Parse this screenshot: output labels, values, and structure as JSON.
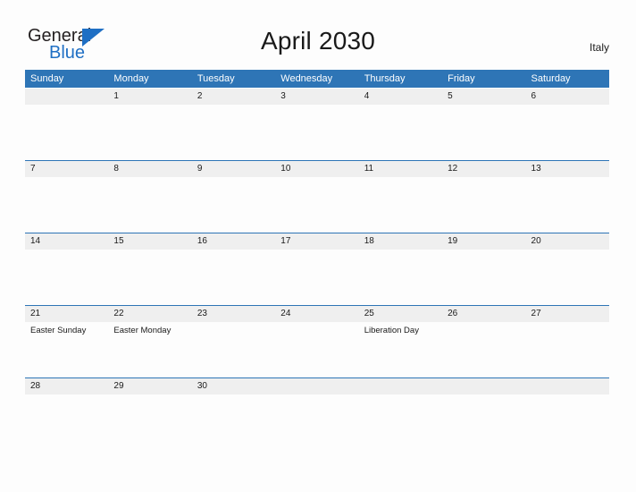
{
  "brand": {
    "name_part1": "General",
    "name_part2": "Blue",
    "triangle_icon": "triangle-icon",
    "accent_color": "#1f6fc4"
  },
  "header": {
    "title": "April 2030",
    "country": "Italy"
  },
  "colors": {
    "header_blue": "#2e75b6",
    "band_gray": "#efefef",
    "page_background": "#fdfdfd",
    "text": "#1a1a1a"
  },
  "calendar": {
    "weekdays": [
      "Sunday",
      "Monday",
      "Tuesday",
      "Wednesday",
      "Thursday",
      "Friday",
      "Saturday"
    ],
    "weeks": [
      {
        "days": [
          {
            "num": "",
            "event": ""
          },
          {
            "num": "1",
            "event": ""
          },
          {
            "num": "2",
            "event": ""
          },
          {
            "num": "3",
            "event": ""
          },
          {
            "num": "4",
            "event": ""
          },
          {
            "num": "5",
            "event": ""
          },
          {
            "num": "6",
            "event": ""
          }
        ]
      },
      {
        "days": [
          {
            "num": "7",
            "event": ""
          },
          {
            "num": "8",
            "event": ""
          },
          {
            "num": "9",
            "event": ""
          },
          {
            "num": "10",
            "event": ""
          },
          {
            "num": "11",
            "event": ""
          },
          {
            "num": "12",
            "event": ""
          },
          {
            "num": "13",
            "event": ""
          }
        ]
      },
      {
        "days": [
          {
            "num": "14",
            "event": ""
          },
          {
            "num": "15",
            "event": ""
          },
          {
            "num": "16",
            "event": ""
          },
          {
            "num": "17",
            "event": ""
          },
          {
            "num": "18",
            "event": ""
          },
          {
            "num": "19",
            "event": ""
          },
          {
            "num": "20",
            "event": ""
          }
        ]
      },
      {
        "days": [
          {
            "num": "21",
            "event": "Easter Sunday"
          },
          {
            "num": "22",
            "event": "Easter Monday"
          },
          {
            "num": "23",
            "event": ""
          },
          {
            "num": "24",
            "event": ""
          },
          {
            "num": "25",
            "event": "Liberation Day"
          },
          {
            "num": "26",
            "event": ""
          },
          {
            "num": "27",
            "event": ""
          }
        ]
      },
      {
        "days": [
          {
            "num": "28",
            "event": ""
          },
          {
            "num": "29",
            "event": ""
          },
          {
            "num": "30",
            "event": ""
          },
          {
            "num": "",
            "event": ""
          },
          {
            "num": "",
            "event": ""
          },
          {
            "num": "",
            "event": ""
          },
          {
            "num": "",
            "event": ""
          }
        ]
      }
    ]
  }
}
